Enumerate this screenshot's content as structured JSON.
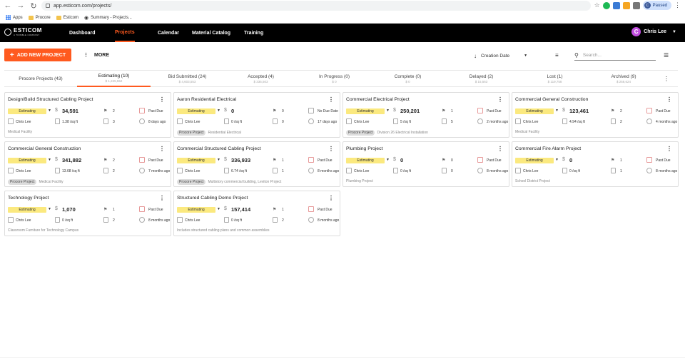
{
  "browser": {
    "url": "app.esticom.com/projects/",
    "bookmarks": [
      "Apps",
      "Procore",
      "Esticom",
      "Summary - Projects..."
    ],
    "profile_status": "Paused",
    "profile_initial": "C"
  },
  "nav": {
    "logo": "ESTICOM",
    "logo_sub": "A TRIMBLE COMPANY",
    "items": [
      "Dashboard",
      "Projects",
      "Calendar",
      "Material Catalog",
      "Training"
    ],
    "active": "Projects",
    "user_name": "Chris Lee",
    "user_initial": "C"
  },
  "toolbar": {
    "add_label": "ADD NEW PROJECT",
    "more_label": "MORE",
    "sort_label": "Creation Date",
    "search_placeholder": "Search..."
  },
  "tabs": [
    {
      "label": "Procore Projects (43)",
      "sub": ""
    },
    {
      "label": "Estimating (10)",
      "sub": "$ 1,245,552"
    },
    {
      "label": "Bid Submitted (24)",
      "sub": "$ 4,603,553"
    },
    {
      "label": "Accepted (4)",
      "sub": "$ 335,503"
    },
    {
      "label": "In Progress (0)",
      "sub": "$ 0"
    },
    {
      "label": "Complete (0)",
      "sub": "$ 0"
    },
    {
      "label": "Delayed (2)",
      "sub": "$ 15,563"
    },
    {
      "label": "Lost (1)",
      "sub": "$ 119,758"
    },
    {
      "label": "Archived (9)",
      "sub": "$ 258,624"
    }
  ],
  "cards": [
    {
      "title": "Design/Build Structured Cabling Project",
      "status": "Estimating",
      "amount": "34,591",
      "flags": "2",
      "due": "Past Due",
      "owner": "Chris Lee",
      "sqft": "1.38 /sq ft",
      "docs": "3",
      "ago": "8 days ago",
      "tag": "",
      "desc": "Medical Facility"
    },
    {
      "title": "Aaron Residential Electrical",
      "status": "Estimating",
      "amount": "0",
      "flags": "0",
      "due": "No Due Date",
      "owner": "Chris Lee",
      "sqft": "0 /sq ft",
      "docs": "0",
      "ago": "17 days ago",
      "tag": "Procore Project",
      "desc": "Residential Electrical"
    },
    {
      "title": "Commercial Electrical Project",
      "status": "Estimating",
      "amount": "250,201",
      "flags": "1",
      "due": "Past Due",
      "owner": "Chris Lee",
      "sqft": "5 /sq ft",
      "docs": "5",
      "ago": "2 months ago",
      "tag": "Procore Project",
      "desc": "Division 26 Electrical Installation"
    },
    {
      "title": "Commercial General Construction",
      "status": "Estimating",
      "amount": "123,461",
      "flags": "2",
      "due": "Past Due",
      "owner": "Chris Lee",
      "sqft": "4.94 /sq ft",
      "docs": "2",
      "ago": "4 months ago",
      "tag": "",
      "desc": "Medical Facility"
    },
    {
      "title": "Commercial General Construction",
      "status": "Estimating",
      "amount": "341,882",
      "flags": "2",
      "due": "Past Due",
      "owner": "Chris Lee",
      "sqft": "13.68 /sq ft",
      "docs": "2",
      "ago": "7 months ago",
      "tag": "Procore Project",
      "desc": "Medical Facility"
    },
    {
      "title": "Commercial Structured Cabling Project",
      "status": "Estimating",
      "amount": "336,933",
      "flags": "1",
      "due": "Past Due",
      "owner": "Chris Lee",
      "sqft": "6.74 /sq ft",
      "docs": "1",
      "ago": "8 months ago",
      "tag": "Procore Project",
      "desc": "Multistory commercial building, Leviton Project"
    },
    {
      "title": "Plumbing Project",
      "status": "Estimating",
      "amount": "0",
      "flags": "0",
      "due": "Past Due",
      "owner": "Chris Lee",
      "sqft": "0 /sq ft",
      "docs": "0",
      "ago": "8 months ago",
      "tag": "",
      "desc": "Plumbing Project"
    },
    {
      "title": "Commercial Fire Alarm Project",
      "status": "Estimating",
      "amount": "0",
      "flags": "1",
      "due": "Past Due",
      "owner": "Chris Lee",
      "sqft": "0 /sq ft",
      "docs": "1",
      "ago": "8 months ago",
      "tag": "",
      "desc": "School District Project"
    },
    {
      "title": "Technology Project",
      "status": "Estimating",
      "amount": "1,070",
      "flags": "1",
      "due": "Past Due",
      "owner": "Chris Lee",
      "sqft": "0 /sq ft",
      "docs": "2",
      "ago": "8 months ago",
      "tag": "",
      "desc": "Classroom Furniture for Technology Campus"
    },
    {
      "title": "Structured Cabling Demo Project",
      "status": "Estimating",
      "amount": "157,414",
      "flags": "1",
      "due": "Past Due",
      "owner": "Chris Lee",
      "sqft": "0 /sq ft",
      "docs": "2",
      "ago": "8 months ago",
      "tag": "",
      "desc": "Includes structured cabling plans and common assemblies"
    }
  ],
  "colors": {
    "accent": "#ff5a1f",
    "badge": "#fbe97f",
    "navbar": "#000000"
  }
}
